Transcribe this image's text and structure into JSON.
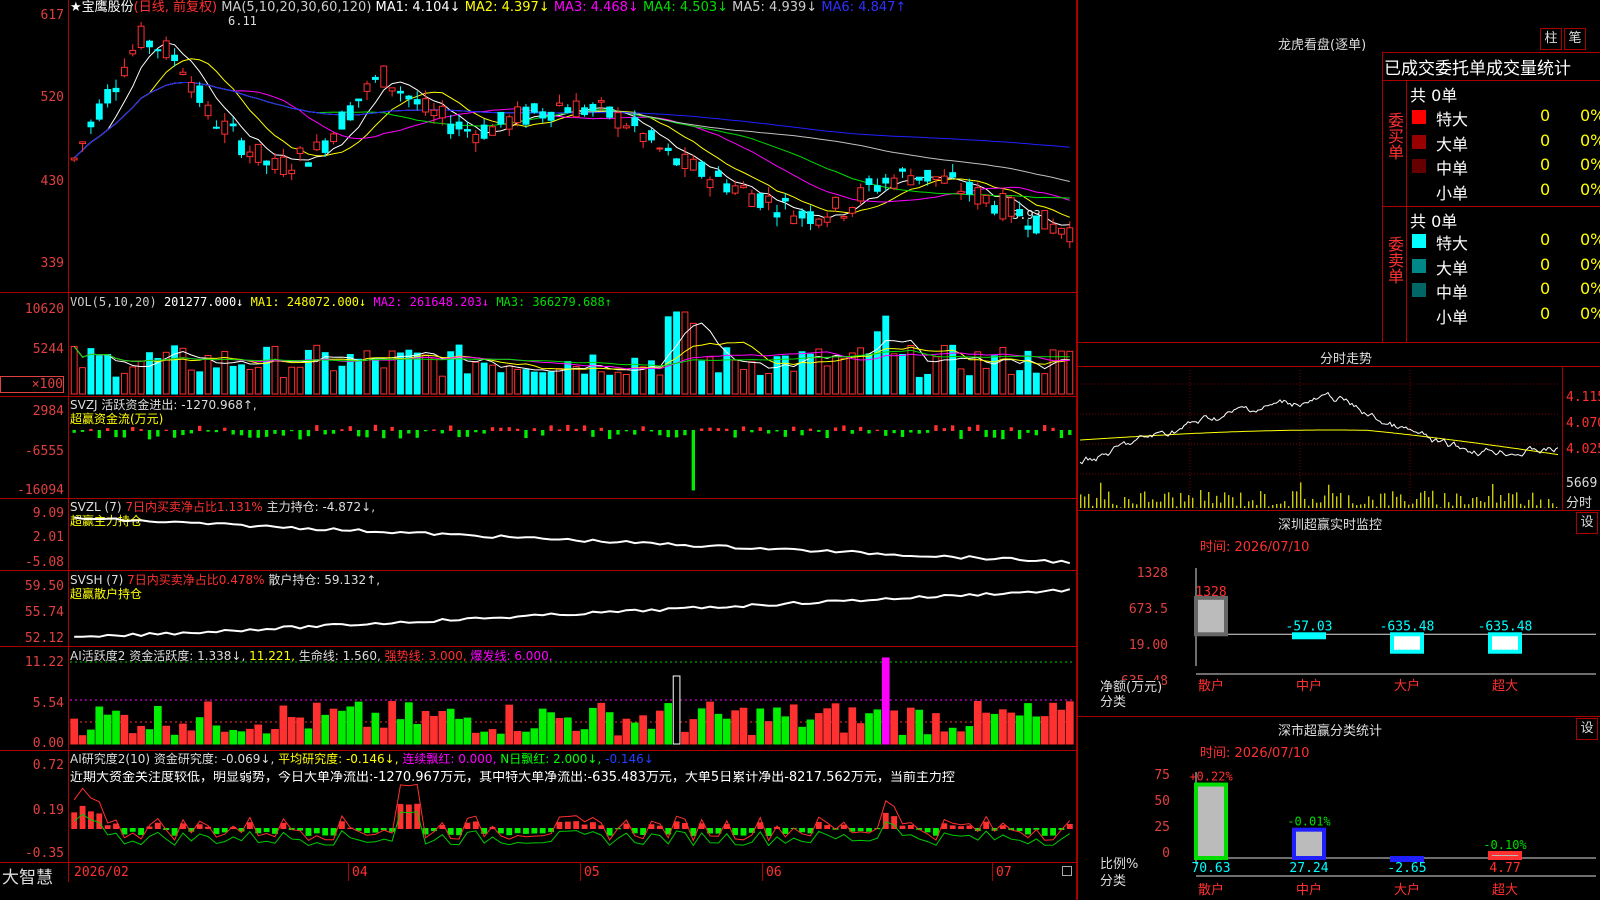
{
  "colors": {
    "up": "#ff3030",
    "down": "#00ffff",
    "bg": "#000000",
    "grid": "#aa0000",
    "white": "#ffffff",
    "yellow": "#ffff00",
    "magenta": "#ff00ff",
    "green": "#00dd00",
    "blue": "#2020ff",
    "gray": "#c0c0c0"
  },
  "header": {
    "title": "★宝鹰股份",
    "period": "(日线, 前复权)",
    "ma_label": "MA(5,10,20,30,60,120)",
    "ma1": "MA1: 4.104↓",
    "ma2": "MA2: 4.397↓",
    "ma3": "MA3: 4.468↓",
    "ma4": "MA4: 4.503↓",
    "ma5": "MA5: 4.939↓",
    "ma6": "MA6: 4.847↑"
  },
  "price_axis": [
    "617",
    "520",
    "430",
    "339"
  ],
  "price_marks": {
    "high": "6.11",
    "low": "3.93→"
  },
  "vol": {
    "label": "VOL(5,10,20)",
    "val": "201277.000↓",
    "ma1": "MA1: 248072.000↓",
    "ma2": "MA2: 261648.203↓",
    "ma3": "MA3: 366279.688↑",
    "axis": [
      "10620",
      "5244",
      "×100"
    ]
  },
  "svzj": {
    "label": "SVZJ  活跃资金进出: -1270.968↑,",
    "sub": "超赢资金流(万元)",
    "axis": [
      "2984",
      "-6555",
      "-16094"
    ]
  },
  "svzl": {
    "label": "SVZL (7)",
    "red": "7日内买卖净占比1.131%",
    "rest": "主力持仓: -4.872↓,",
    "sub": "超赢主力持仓",
    "axis": [
      "9.09",
      "2.01",
      "-5.08"
    ]
  },
  "svsh": {
    "label": "SVSH (7)",
    "red": "7日内买卖净占比0.478%",
    "rest": "散户持仓: 59.132↑,",
    "sub": "超赢散户持仓",
    "axis": [
      "59.50",
      "55.74",
      "52.12"
    ]
  },
  "ai1": {
    "label": "AI活跃度2",
    "a": "资金活跃度: 1.338↓,",
    "b": "11.221,",
    "c": "生命线: 1.560,",
    "d": "强势线: 3.000,",
    "e": "爆发线: 6.000,",
    "axis": [
      "11.22",
      "5.54",
      "0.00"
    ]
  },
  "ai2": {
    "label": "AI研究度2(10)",
    "a": "资金研究度: -0.069↓,",
    "b": "平均研究度: -0.146↓,",
    "c": "连续飘红: 0.000,",
    "d": "N日飘红: 2.000↓,",
    "e": "-0.146↓",
    "text": "近期大资金关注度较低，明显弱势，今日大单净流出:-1270.967万元，其中特大单净流出:-635.483万元，大单5日累计净出-8217.562万元，当前主力控",
    "axis": [
      "0.72",
      "0.19",
      "-0.35"
    ]
  },
  "dates": [
    "2026/02",
    "04",
    "05",
    "06",
    "07"
  ],
  "footer": {
    "brand": "大智慧"
  },
  "right": {
    "lhb_title": "龙虎看盘(逐单)",
    "btn1": "柱",
    "btn2": "笔",
    "stat_title": "已成交委托单成交量统计",
    "buy_side": "委买单",
    "sell_side": "委卖单",
    "buy_total": "共 0单",
    "sell_total": "共 0单",
    "buy_rows": [
      {
        "name": "特大",
        "v": "0",
        "p": "0%",
        "c": "#ff0000"
      },
      {
        "name": "大单",
        "v": "0",
        "p": "0%",
        "c": "#990000"
      },
      {
        "name": "中单",
        "v": "0",
        "p": "0%",
        "c": "#660000"
      },
      {
        "name": "小单",
        "v": "0",
        "p": "0%",
        "c": ""
      }
    ],
    "sell_rows": [
      {
        "name": "特大",
        "v": "0",
        "p": "0%",
        "c": "#00ffff"
      },
      {
        "name": "大单",
        "v": "0",
        "p": "0%",
        "c": "#008888"
      },
      {
        "name": "中单",
        "v": "0",
        "p": "0%",
        "c": "#006666"
      },
      {
        "name": "小单",
        "v": "0",
        "p": "0%",
        "c": ""
      }
    ],
    "fs_title": "分时走势",
    "fs_axis": [
      "4.115",
      "4.070",
      "4.025"
    ],
    "fs_vol": "5669",
    "fs_vol_label": "分时",
    "sz_title": "深圳超赢实时监控",
    "sz_btn": "设",
    "time_label": "时间: 2026/07/10",
    "sz_axis": [
      "1328",
      "673.5",
      "19.00",
      "-635.48"
    ],
    "sz_bars": [
      {
        "cat": "散户",
        "v": "1328",
        "val": 1328
      },
      {
        "cat": "中户",
        "v": "-57.03",
        "val": -57.03
      },
      {
        "cat": "大户",
        "v": "-635.48",
        "val": -635.48
      },
      {
        "cat": "超大",
        "v": "-635.48",
        "val": -635.48
      }
    ],
    "sz_ylabel": "净额(万元)",
    "sz_xlabel": "分类",
    "cls_title": "深市超赢分类统计",
    "cls_btn": "设",
    "cls_axis": [
      "75",
      "50",
      "25",
      "0"
    ],
    "cls_bars": [
      {
        "cat": "散户",
        "top": "+0.22%",
        "bot": "70.63",
        "val": 70.63
      },
      {
        "cat": "中户",
        "top": "-0.01%",
        "bot": "27.24",
        "val": 27.24
      },
      {
        "cat": "大户",
        "top": "",
        "bot": "-2.65",
        "val": -2.65
      },
      {
        "cat": "超大",
        "top": "-0.10%",
        "bot": "4.77",
        "val": 4.77
      }
    ],
    "cls_ylabel": "比例%",
    "cls_xlabel": "分类"
  }
}
